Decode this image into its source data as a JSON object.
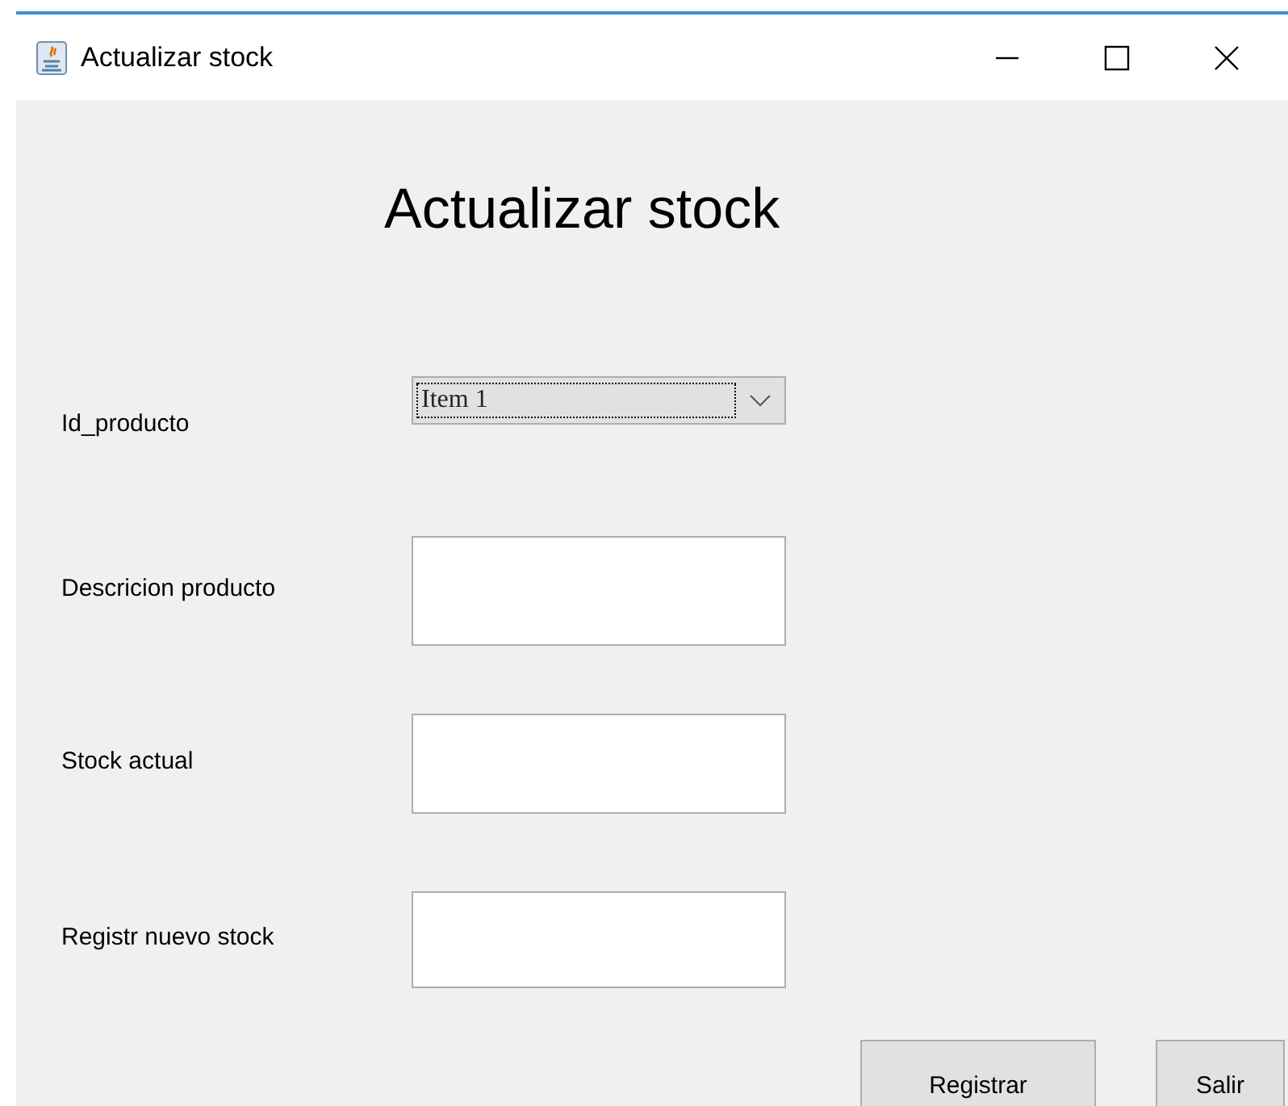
{
  "window": {
    "title": "Actualizar stock"
  },
  "heading": "Actualizar stock",
  "fields": [
    {
      "label": "Id_producto",
      "kind": "combo",
      "value": "Item 1",
      "focused": true
    },
    {
      "label": "Descricion producto",
      "kind": "text"
    },
    {
      "label": "Stock actual",
      "kind": "text"
    },
    {
      "label": "Registr nuevo stock",
      "kind": "text"
    }
  ],
  "buttons": [
    "Registrar",
    "Salir"
  ]
}
